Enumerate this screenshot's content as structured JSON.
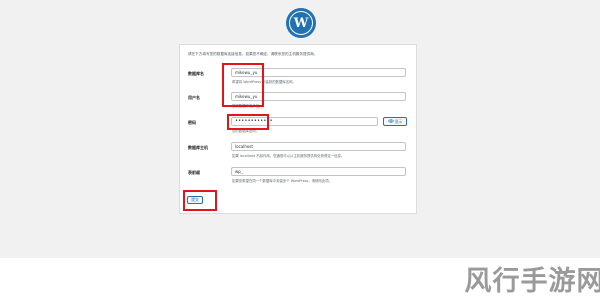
{
  "logo": {
    "glyph": "W"
  },
  "form": {
    "intro": "请在下方填写您的数据库连接信息。如果您不确定，请联系您的主机服务提供商。",
    "fields": [
      {
        "label": "数据库名",
        "value": "mikewu_yu",
        "hint": "希望将 WordPress 安装到的数据库名称。"
      },
      {
        "label": "用户名",
        "value": "mikewu_yu",
        "hint": "您的数据库用户名。"
      },
      {
        "label": "密码",
        "value": "••••••••••••",
        "hint": "您的数据库密码。",
        "show_label": "显示",
        "show_icon": "eye-icon"
      },
      {
        "label": "数据库主机",
        "value": "localhost",
        "hint": "如果 localhost 不起作用，您通常可以从主机服务提供商处获得这一信息。"
      },
      {
        "label": "表前缀",
        "value": "wp_",
        "hint": "如果您希望在同一个数据库中安装多个 WordPress，请修改此项。"
      }
    ],
    "submit_label": "提交"
  },
  "highlight_color": "#e0161b",
  "watermark": "风行手游网"
}
